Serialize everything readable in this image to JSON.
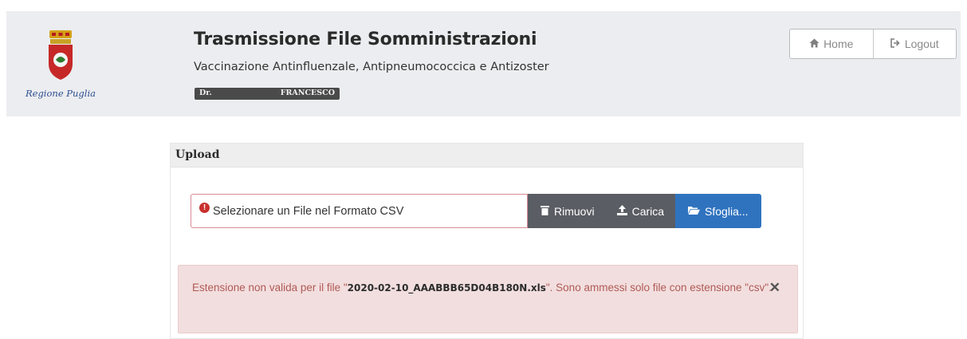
{
  "header": {
    "logo_text": "Regione Puglia",
    "title": "Trasmissione File Somministrazioni",
    "subtitle": "Vaccinazione Antinfluenzale, Antipneumococcica e Antizoster",
    "user_title": "Dr.",
    "user_name": "FRANCESCO"
  },
  "nav": {
    "home_label": "Home",
    "logout_label": "Logout",
    "home_icon": "home-icon",
    "logout_icon": "sign-out-icon"
  },
  "upload": {
    "panel_title": "Upload",
    "file_placeholder": "Selezionare un File nel Formato CSV",
    "remove_label": "Rimuovi",
    "upload_label": "Carica",
    "browse_label": "Sfoglia..."
  },
  "alert": {
    "message_prefix": "Estensione non valida per il file \"",
    "filename": "2020-02-10_AAABBB65D04B180N.xls",
    "message_suffix": "\". Sono ammessi solo file con estensione \"csv\".",
    "close_symbol": "✕"
  },
  "colors": {
    "header_bg": "#ecedf0",
    "button_dark": "#5a5d63",
    "button_blue": "#2f73bf",
    "alert_bg": "#f2dede",
    "alert_text": "#b05a56",
    "error_red": "#c9302c"
  }
}
